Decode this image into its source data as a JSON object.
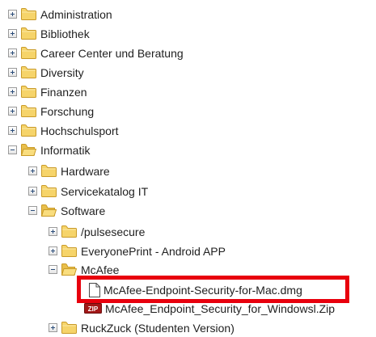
{
  "tree": {
    "items": [
      {
        "label": "Administration"
      },
      {
        "label": "Bibliothek"
      },
      {
        "label": "Career Center und Beratung"
      },
      {
        "label": "Diversity"
      },
      {
        "label": "Finanzen"
      },
      {
        "label": "Forschung"
      },
      {
        "label": "Hochschulsport"
      },
      {
        "label": "Informatik"
      },
      {
        "label": "Hardware"
      },
      {
        "label": "Servicekatalog IT"
      },
      {
        "label": "Software"
      },
      {
        "label": "/pulsesecure"
      },
      {
        "label": "EveryonePrint - Android APP"
      },
      {
        "label": "McAfee"
      },
      {
        "label": "McAfee-Endpoint-Security-for-Mac.dmg"
      },
      {
        "label": "McAfee_Endpoint_Security_for_Windowsl.Zip"
      },
      {
        "label": "RuckZuck (Studenten Version)"
      }
    ]
  },
  "colors": {
    "folder": "#f3c94f",
    "highlight": "#e8000d",
    "zip": "#a31818"
  },
  "icons": {
    "expand": "plus-box-icon",
    "collapse": "minus-box-icon",
    "folder": "folder-icon",
    "file": "document-icon",
    "zip": "zip-archive-icon"
  }
}
